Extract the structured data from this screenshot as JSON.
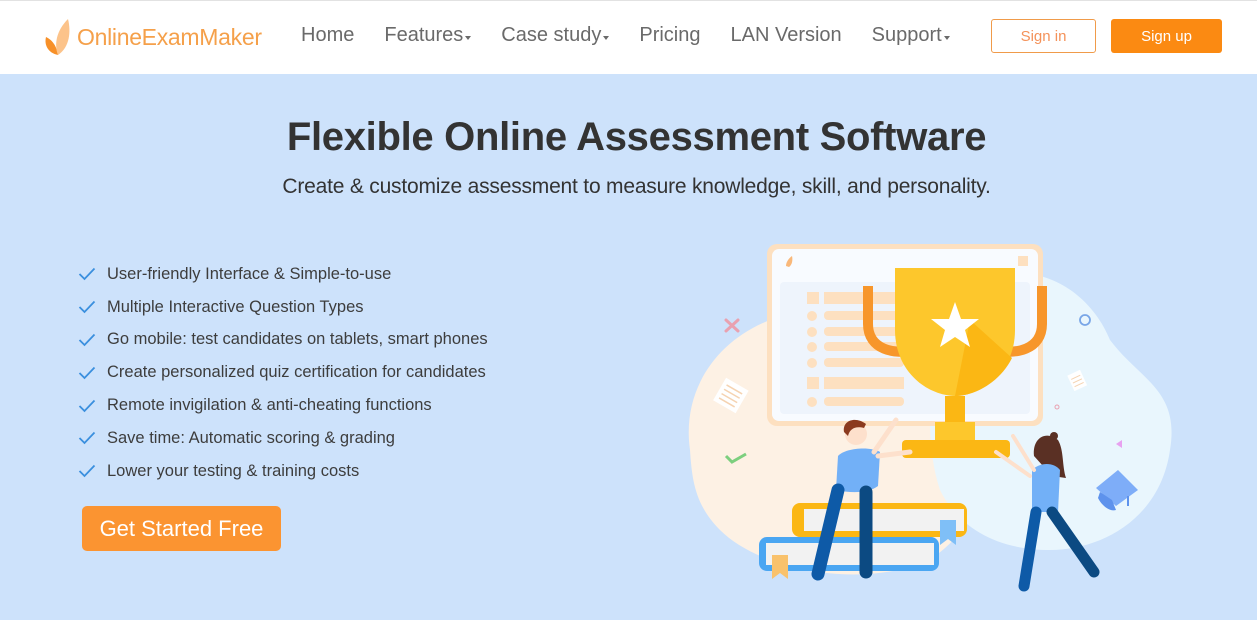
{
  "brand": {
    "name": "OnlineExamMaker",
    "accent_color": "#fb8a12",
    "logo_icon": "leaf-logo-icon"
  },
  "nav": {
    "items": [
      {
        "label": "Home",
        "has_dropdown": false
      },
      {
        "label": "Features",
        "has_dropdown": true
      },
      {
        "label": "Case study",
        "has_dropdown": true
      },
      {
        "label": "Pricing",
        "has_dropdown": false
      },
      {
        "label": "LAN Version",
        "has_dropdown": false
      },
      {
        "label": "Support",
        "has_dropdown": true
      }
    ],
    "signin_label": "Sign in",
    "signup_label": "Sign up"
  },
  "hero": {
    "title": "Flexible Online Assessment Software",
    "subtitle": "Create & customize assessment to measure knowledge, skill, and personality.",
    "features": [
      "User-friendly Interface & Simple-to-use",
      "Multiple Interactive Question Types",
      "Go mobile: test candidates on tablets, smart phones",
      "Create personalized quiz certification for candidates",
      "Remote invigilation & anti-cheating functions",
      "Save time: Automatic scoring & grading",
      "Lower your testing & training costs"
    ],
    "cta_label": "Get Started Free",
    "check_icon": "checkmark-icon",
    "illustration": "trophy-celebration-illustration"
  }
}
